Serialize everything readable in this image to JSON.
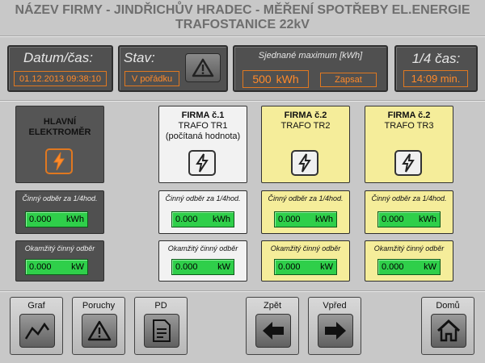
{
  "header": {
    "title_line1": "NÁZEV FIRMY - JINDŘICHŮV HRADEC - MĚŘENÍ SPOTŘEBY EL.ENERGIE",
    "title_line2": "TRAFOSTANICE 22kV"
  },
  "status_bar": {
    "datetime_label": "Datum/čas:",
    "datetime_value": "01.12.2013 09:38:10",
    "state_label": "Stav:",
    "state_value": "V pořádku",
    "agreed_max_label": "Sjednané maximum [kWh]",
    "agreed_max_value": "500",
    "agreed_max_unit": "kWh",
    "save_button": "Zapsat",
    "quarter_label": "1/4 čas:",
    "quarter_value": "14:09 min."
  },
  "cards": [
    {
      "title": "HLAVNÍ",
      "title2": "ELEKTROMĚR",
      "sub1": "",
      "sub2": ""
    },
    {
      "title": "FIRMA č.1",
      "title2": "",
      "sub1": "TRAFO TR1",
      "sub2": "(počítaná hodnota)"
    },
    {
      "title": "FIRMA č.2",
      "title2": "",
      "sub1": "TRAFO TR2",
      "sub2": ""
    },
    {
      "title": "FIRMA č.2",
      "title2": "",
      "sub1": "TRAFO TR3",
      "sub2": ""
    }
  ],
  "meters": {
    "quarter_label": "Činný odběr za 1/4hod.",
    "instant_label": "Okamžitý činný odběr",
    "quarter_value": "0.000",
    "quarter_unit": "kWh",
    "instant_value": "0.000",
    "instant_unit": "kW"
  },
  "nav": {
    "graph": "Graf",
    "faults": "Poruchy",
    "pd": "PD",
    "back": "Zpět",
    "forward": "Vpřed",
    "home": "Domů"
  },
  "colors": {
    "background": "#c8c8c8",
    "panel": "#505050",
    "accent_orange": "#ff8a2a",
    "value_green": "#2fcf4a",
    "card_yellow": "#f5ed9a"
  }
}
